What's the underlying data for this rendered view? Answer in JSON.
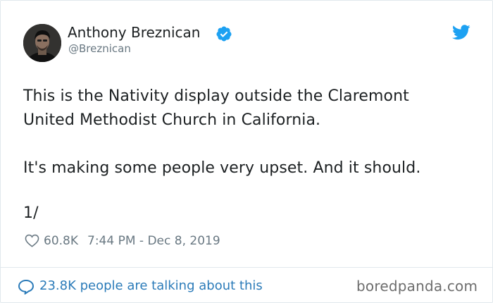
{
  "tweet": {
    "author_name": "Anthony Breznican",
    "handle": "@Breznican",
    "text_lines": [
      "This is the Nativity display outside the Claremont",
      "United Methodist Church in California.",
      "It's making some people very upset. And it should.",
      "1/"
    ],
    "likes": "60.8K",
    "time": "7:44 PM",
    "separator": "-",
    "date": "Dec 8, 2019",
    "talking": "23.8K people are talking about this"
  },
  "icons": {
    "verified": "verified-badge-icon",
    "brand": "twitter-bird-icon",
    "like": "heart-outline-icon",
    "reply": "speech-bubble-icon",
    "avatar": "profile-photo"
  },
  "watermark": "boredpanda.com",
  "colors": {
    "text": "#1c2022",
    "secondary": "#697882",
    "link": "#2b7bb9",
    "verified": "#1da1f2",
    "border": "#e1e8ed"
  }
}
